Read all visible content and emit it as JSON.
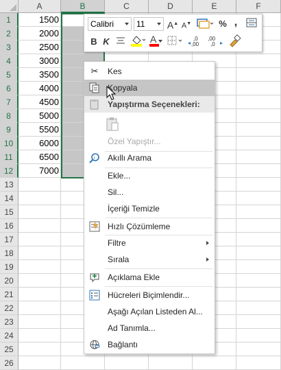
{
  "columns": [
    "A",
    "B",
    "C",
    "D",
    "E",
    "F"
  ],
  "rows": [
    "1",
    "2",
    "3",
    "4",
    "5",
    "6",
    "7",
    "8",
    "9",
    "10",
    "11",
    "12",
    "13",
    "14",
    "15",
    "16",
    "17",
    "18",
    "19",
    "20",
    "21",
    "22",
    "23",
    "24",
    "25",
    "26"
  ],
  "col_a_values": [
    "1500",
    "2000",
    "2500",
    "3000",
    "3500",
    "4000",
    "4500",
    "5000",
    "5500",
    "6000",
    "6500",
    "7000"
  ],
  "mini_toolbar": {
    "font_name": "Calibri",
    "font_size": "11",
    "increase_font": "A",
    "decrease_font": "A",
    "percent": "%",
    "comma": ",",
    "bold": "B",
    "italic": "K",
    "font_color_letter": "A",
    "inc_decimal": "←,00",
    "dec_decimal": ",00→,0",
    "highlight_color": "#ffff00",
    "font_color": "#ff0000"
  },
  "menu": {
    "cut": "Kes",
    "copy": "Kopyala",
    "paste_options": "Yapıştırma Seçenekleri:",
    "paste_special": "Özel Yapıştır...",
    "smart_lookup": "Akıllı Arama",
    "insert": "Ekle...",
    "delete": "Sil...",
    "clear_contents": "İçeriği Temizle",
    "quick_analysis": "Hızlı Çözümleme",
    "filter": "Filtre",
    "sort": "Sırala",
    "insert_comment": "Açıklama Ekle",
    "format_cells": "Hücreleri Biçimlendir...",
    "pick_from_list": "Aşağı Açılan Listeden Al...",
    "define_name": "Ad Tanımla...",
    "hyperlink": "Bağlantı"
  },
  "colors": {
    "selection": "#217346",
    "menu_highlight": "#c5c5c5"
  }
}
